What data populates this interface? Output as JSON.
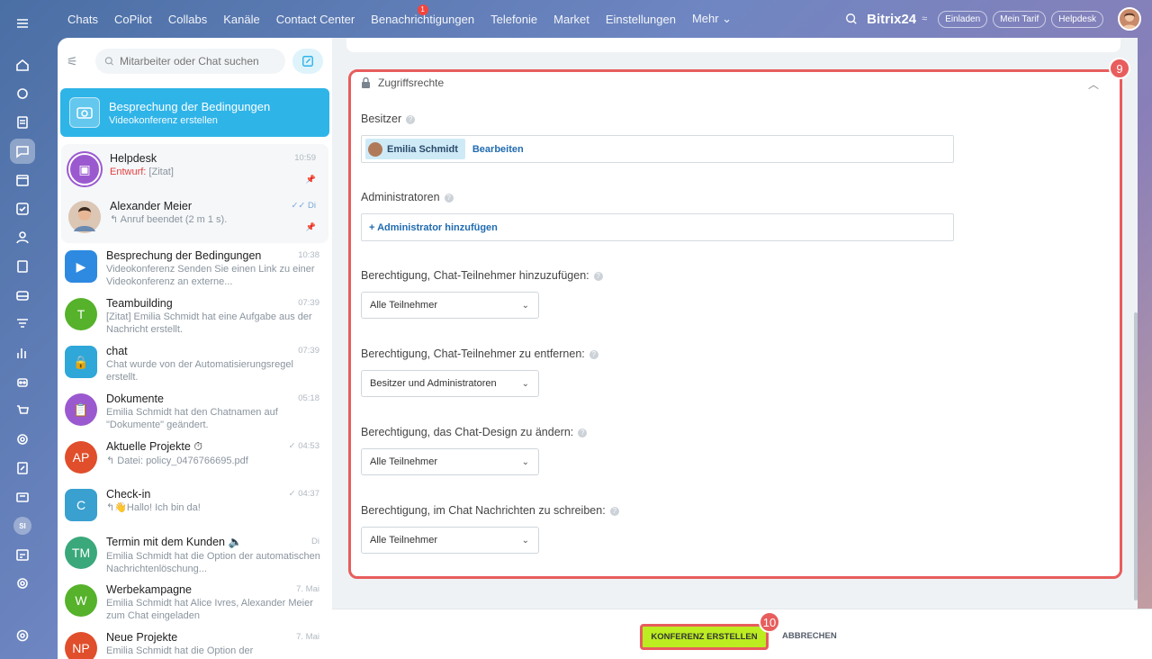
{
  "topnav": {
    "items": [
      "Chats",
      "CoPilot",
      "Collabs",
      "Kanäle",
      "Contact Center",
      "Benachrichtigungen",
      "Telefonie",
      "Market",
      "Einstellungen",
      "Mehr ⌄"
    ],
    "notif_badge": "1",
    "brand": "Bitrix24",
    "brand_sub": "≈",
    "pills": [
      "Einladen",
      "Mein Tarif",
      "Helpdesk"
    ]
  },
  "rail": {
    "si_label": "SI"
  },
  "search": {
    "placeholder": "Mitarbeiter oder Chat suchen"
  },
  "active_chat": {
    "title": "Besprechung der Bedingungen",
    "subtitle": "Videokonferenz erstellen"
  },
  "pinned": [
    {
      "name": "Helpdesk",
      "draft_prefix": "Entwurf:",
      "msg": " [Zitat]",
      "time": "10:59",
      "color": "#9b59d0",
      "icon": "📋"
    },
    {
      "name": "Alexander Meier",
      "msg": "↰ Anruf beendet (2 m 1 s).",
      "time": "✓✓ Di",
      "color": "#7a5a4a",
      "icon": "👤"
    }
  ],
  "chats": [
    {
      "name": "Besprechung der Bedingungen",
      "msg": "Videokonferenz Senden Sie einen Link zu einer Videokonferenz an externe...",
      "time": "10:38",
      "color": "#2e8ae0",
      "initial": "▶",
      "square": true
    },
    {
      "name": "Teambuilding",
      "msg": "[Zitat] Emilia Schmidt hat eine Aufgabe aus der Nachricht erstellt.",
      "time": "07:39",
      "color": "#55b22a",
      "initial": "T"
    },
    {
      "name": "chat",
      "msg": "Chat wurde von der Automatisierungsregel erstellt.",
      "time": "07:39",
      "color": "#2fa7d8",
      "initial": "🔒",
      "square": true
    },
    {
      "name": "Dokumente",
      "msg": "Emilia Schmidt hat den Chatnamen auf \"Dokumente\" geändert.",
      "time": "05:18",
      "color": "#9b59d0",
      "initial": "📋"
    },
    {
      "name": "Aktuelle Projekte ⏱",
      "msg": "↰ Datei: policy_0476766695.pdf",
      "time": "✓ 04:53",
      "color": "#e04e2b",
      "initial": "AP"
    },
    {
      "name": "Check-in",
      "msg": "↰👋Hallo! Ich bin da!",
      "time": "✓ 04:37",
      "color": "#3aa0d0",
      "initial": "C",
      "square": true
    },
    {
      "name": "Termin mit dem Kunden 🔈",
      "msg": "Emilia Schmidt hat die Option der automatischen Nachrichtenlöschung...",
      "time": "Di",
      "color": "#3aa87a",
      "initial": "TM"
    },
    {
      "name": "Werbekampagne",
      "msg": "Emilia Schmidt hat Alice Ivres, Alexander Meier zum Chat eingeladen",
      "time": "7. Mai",
      "color": "#55b22a",
      "initial": "W"
    },
    {
      "name": "Neue Projekte",
      "msg": "Emilia Schmidt hat die Option der",
      "time": "7. Mai",
      "color": "#e04e2b",
      "initial": "NP"
    }
  ],
  "access": {
    "header": "Zugriffsrechte",
    "owner_label": "Besitzer",
    "owner_name": "Emilia Schmidt",
    "edit_link": "Bearbeiten",
    "admins_label": "Administratoren",
    "add_admin": "+ Administrator hinzufügen",
    "perms": [
      {
        "label": "Berechtigung, Chat-Teilnehmer hinzuzufügen:",
        "value": "Alle Teilnehmer"
      },
      {
        "label": "Berechtigung, Chat-Teilnehmer zu entfernen:",
        "value": "Besitzer und Administratoren"
      },
      {
        "label": "Berechtigung, das Chat-Design zu ändern:",
        "value": "Alle Teilnehmer"
      },
      {
        "label": "Berechtigung, im Chat Nachrichten zu schreiben:",
        "value": "Alle Teilnehmer"
      }
    ],
    "step_badge": "9"
  },
  "footer": {
    "create_label": "KONFERENZ ERSTELLEN",
    "cancel_label": "ABBRECHEN",
    "step_badge": "10"
  },
  "colors": {
    "accent": "#2fb4e8",
    "highlight": "#e85d5d",
    "create_btn": "#bbed21"
  }
}
